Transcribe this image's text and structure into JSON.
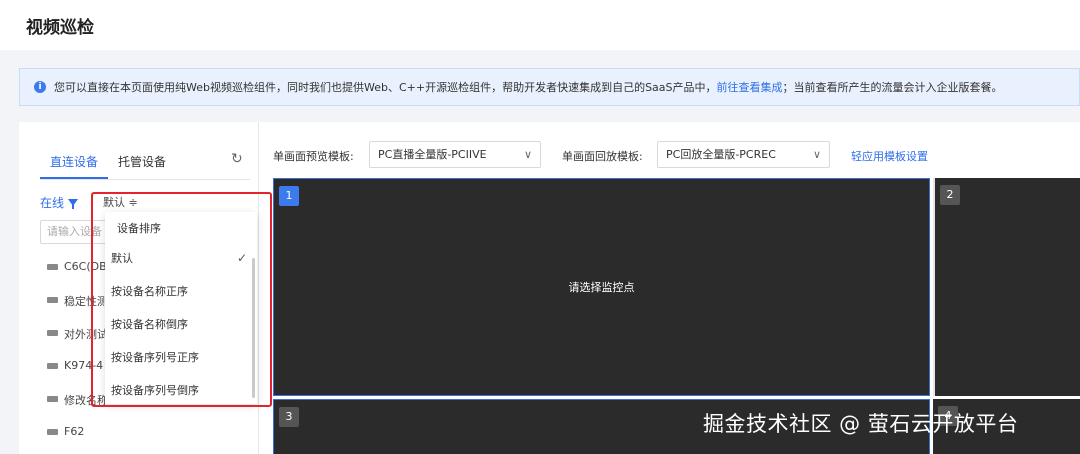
{
  "page": {
    "title": "视频巡检"
  },
  "notice": {
    "text": "您可以直接在本页面使用纯Web视频巡检组件，同时我们也提供Web、C++开源巡检组件，帮助开发者快速集成到自己的SaaS产品中，",
    "link": "前往查看集成",
    "suffix": "；当前查看所产生的流量会计入企业版套餐。"
  },
  "sidebar": {
    "tabs": [
      {
        "label": "直连设备"
      },
      {
        "label": "托管设备"
      }
    ],
    "online_label": "在线",
    "sort_label": "默认 ≑",
    "search_placeholder": "请输入设备",
    "devices": [
      {
        "name": "C6C(DB"
      },
      {
        "name": "稳定性测"
      },
      {
        "name": "对外测试"
      },
      {
        "name": "K974-4"
      },
      {
        "name": "修改名称"
      },
      {
        "name": "F62"
      }
    ]
  },
  "sort_dropdown": {
    "title": "设备排序",
    "items": [
      {
        "label": "默认",
        "selected": true
      },
      {
        "label": "按设备名称正序"
      },
      {
        "label": "按设备名称倒序"
      },
      {
        "label": "按设备序列号正序"
      },
      {
        "label": "按设备序列号倒序"
      }
    ]
  },
  "toolbar": {
    "preview_label": "单画面预览模板:",
    "preview_value": "PC直播全量版-PCIIVE",
    "playback_label": "单画面回放模板:",
    "playback_value": "PC回放全量版-PCREC",
    "apply_link": "轻应用模板设置"
  },
  "grid": {
    "cells": [
      {
        "num": "1"
      },
      {
        "num": "2"
      },
      {
        "num": "3"
      },
      {
        "num": "4"
      }
    ],
    "placeholder": "请选择监控点"
  },
  "watermark": "掘金技术社区 @ 萤石云开放平台",
  "colors": {
    "accent": "#2f6ee8",
    "highlight": "#e3242b",
    "video_bg": "#2b2b2b"
  }
}
